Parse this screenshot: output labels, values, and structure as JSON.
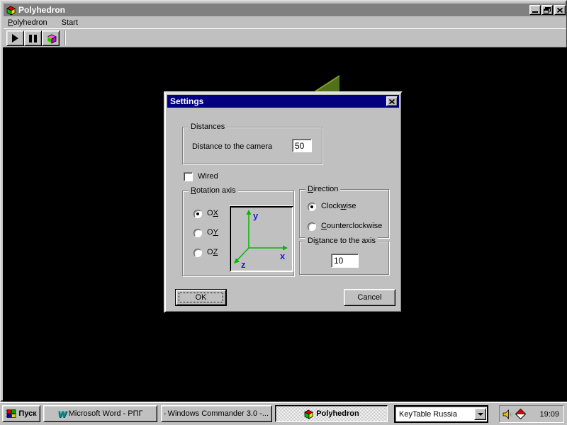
{
  "colors": {
    "chrome": "#c0c0c0",
    "active_title": "#000080",
    "inactive_title": "#808080",
    "desktop": "#000000",
    "axis_green": "#00b800",
    "axis_label_blue": "#2020cc",
    "polyhedron_triangle": "#50701c"
  },
  "window": {
    "title": "Polyhedron",
    "menu_items": [
      {
        "pre": "",
        "key": "P",
        "post": "olyhedron"
      },
      {
        "pre": "Start",
        "key": "",
        "post": ""
      }
    ]
  },
  "toolbar": {
    "buttons": [
      {
        "icon": "play-icon"
      },
      {
        "icon": "pause-icon"
      },
      {
        "icon": "cube-icon"
      }
    ]
  },
  "dialog": {
    "title": "Settings",
    "distances_group": {
      "label": "Distances",
      "camera_label": "Distance to the camera",
      "camera_value": "50"
    },
    "wired_checkbox": {
      "label": "Wired",
      "checked": false
    },
    "rotation_group": {
      "label": {
        "pre": "",
        "key": "R",
        "post": "otation axis"
      },
      "options": [
        {
          "pre": "O",
          "key": "X",
          "post": "",
          "selected": true
        },
        {
          "pre": "O",
          "key": "Y",
          "post": "",
          "selected": false
        },
        {
          "pre": "O",
          "key": "Z",
          "post": "",
          "selected": false
        }
      ],
      "axis_labels": {
        "x": "x",
        "y": "y",
        "z": "z"
      }
    },
    "direction_group": {
      "label": {
        "pre": "",
        "key": "D",
        "post": "irection"
      },
      "options": [
        {
          "pre": "Clock",
          "key": "w",
          "post": "ise",
          "selected": true
        },
        {
          "pre": "",
          "key": "C",
          "post": "ounterclockwise",
          "selected": false
        }
      ]
    },
    "axis_distance_group": {
      "label": {
        "pre": "Di",
        "key": "s",
        "post": "tance to the axis"
      },
      "value": "10"
    },
    "buttons": {
      "ok": "OK",
      "cancel": "Cancel"
    }
  },
  "taskbar": {
    "start_label": "Пуск",
    "tasks": [
      {
        "label": "Microsoft Word - РПГ",
        "icon": "word-icon",
        "icon_letter": "W",
        "active": false
      },
      {
        "label": "Windows Commander 3.0 -...",
        "icon": "floppy-icon",
        "active": false
      },
      {
        "label": "Polyhedron",
        "icon": "cube-icon",
        "active": true
      }
    ],
    "layout_combo": {
      "value": "KeyTable Russia"
    },
    "tray": {
      "time": "19:09",
      "icons": [
        "speaker-icon",
        "layout-diamond-icon"
      ]
    }
  }
}
